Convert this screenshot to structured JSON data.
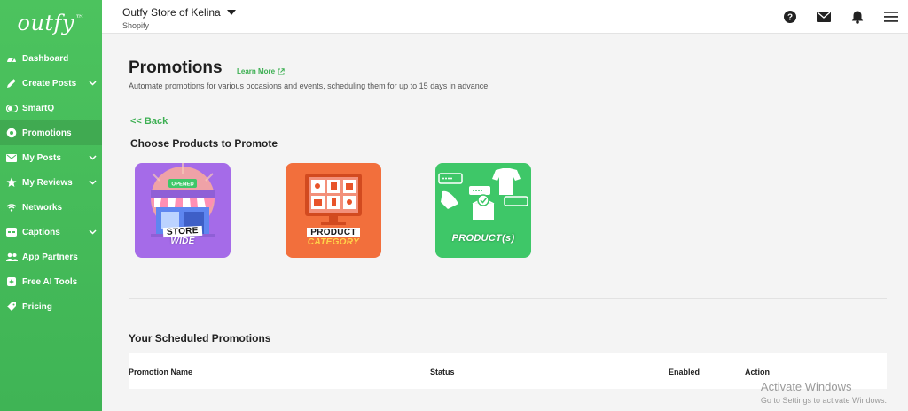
{
  "brand": {
    "logo_text": "outfy",
    "logo_tm": "™"
  },
  "sidebar": {
    "items": [
      {
        "label": "Dashboard",
        "icon": "gauge-icon",
        "has_chevron": false,
        "active": false
      },
      {
        "label": "Create Posts",
        "icon": "pencil-icon",
        "has_chevron": true,
        "active": false
      },
      {
        "label": "SmartQ",
        "icon": "toggle-icon",
        "has_chevron": false,
        "active": false
      },
      {
        "label": "Promotions",
        "icon": "gear-icon",
        "has_chevron": false,
        "active": true
      },
      {
        "label": "My Posts",
        "icon": "envelope-icon",
        "has_chevron": true,
        "active": false
      },
      {
        "label": "My Reviews",
        "icon": "star-icon",
        "has_chevron": true,
        "active": false
      },
      {
        "label": "Networks",
        "icon": "wifi-icon",
        "has_chevron": false,
        "active": false
      },
      {
        "label": "Captions",
        "icon": "captions-icon",
        "has_chevron": true,
        "active": false
      },
      {
        "label": "App Partners",
        "icon": "users-icon",
        "has_chevron": false,
        "active": false
      },
      {
        "label": "Free AI Tools",
        "icon": "sparkle-box-icon",
        "has_chevron": false,
        "active": false
      },
      {
        "label": "Pricing",
        "icon": "tag-icon",
        "has_chevron": false,
        "active": false
      }
    ]
  },
  "header": {
    "store_name": "Outfy Store of Kelina",
    "platform": "Shopify",
    "icons": [
      "help-icon",
      "mail-icon",
      "bell-icon",
      "menu-icon"
    ]
  },
  "main": {
    "title": "Promotions",
    "learn_more": "Learn More",
    "subtitle": "Automate promotions for various occasions and events, scheduling them for up to 15 days in advance",
    "back": "<< Back",
    "choose_title": "Choose Products to Promote",
    "cards": [
      {
        "line1": "STORE",
        "line2": "WIDE",
        "sign": "OPENED"
      },
      {
        "line1": "PRODUCT",
        "line2": "CATEGORY"
      },
      {
        "line1": "PRODUCT(s)",
        "line2": ""
      }
    ],
    "scheduled_title": "Your Scheduled Promotions",
    "table_headers": [
      "Promotion Name",
      "Status",
      "Enabled",
      "Action"
    ]
  },
  "watermark": {
    "line1": "Activate Windows",
    "line2": "Go to Settings to activate Windows."
  },
  "colors": {
    "sidebar": "#45bd5a",
    "accent": "#3caf52",
    "card_store": "#a56be8",
    "card_category": "#f26f3c",
    "card_product": "#3ec768"
  }
}
